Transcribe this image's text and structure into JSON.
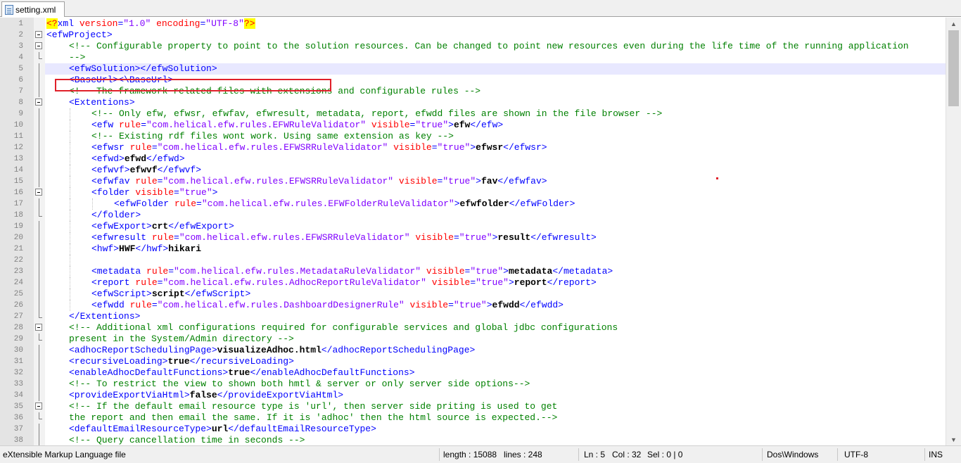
{
  "tab": {
    "label": "setting.xml"
  },
  "status": {
    "file_type": "eXtensible Markup Language file",
    "length": "length : 15088",
    "lines": "lines : 248",
    "ln": "Ln : 5",
    "col": "Col : 32",
    "sel": "Sel : 0 | 0",
    "eol": "Dos\\Windows",
    "encoding": "UTF-8",
    "mode": "INS"
  },
  "colors": {
    "tag": "#0000ff",
    "attr": "#ff0000",
    "value": "#8000ff",
    "comment": "#008000",
    "highlight": "#e0202a"
  },
  "lines": [
    {
      "n": "1",
      "i": 0,
      "s": [
        [
          "pi",
          "<?"
        ],
        [
          "tag",
          "xml "
        ],
        [
          "attr",
          "version"
        ],
        [
          "tag",
          "="
        ],
        [
          "val",
          "\"1.0\" "
        ],
        [
          "attr",
          "encoding"
        ],
        [
          "tag",
          "="
        ],
        [
          "val",
          "\"UTF-8\""
        ],
        [
          "pi",
          "?>"
        ]
      ]
    },
    {
      "n": "2",
      "i": 0,
      "s": [
        [
          "tag",
          "<efwProject>"
        ]
      ]
    },
    {
      "n": "3",
      "i": 1,
      "s": [
        [
          "com",
          "<!-- Configurable property to point to the solution resources. Can be changed to point new resources even during the life time of the running application"
        ]
      ]
    },
    {
      "n": "4",
      "i": 1,
      "s": [
        [
          "com",
          "-->"
        ]
      ]
    },
    {
      "n": "5",
      "i": 1,
      "cur": true,
      "s": [
        [
          "tag",
          "<efwSolution></efwSolution>"
        ]
      ]
    },
    {
      "n": "6",
      "i": 1,
      "s": [
        [
          "tag",
          "<BaseUrl><\\BaseUrl>"
        ]
      ]
    },
    {
      "n": "7",
      "i": 1,
      "s": [
        [
          "com",
          "<!-- The framework related files with extensions and configurable rules -->"
        ]
      ]
    },
    {
      "n": "8",
      "i": 1,
      "s": [
        [
          "tag",
          "<Extentions>"
        ]
      ]
    },
    {
      "n": "9",
      "i": 2,
      "s": [
        [
          "com",
          "<!-- Only efw, efwsr, efwfav, efwresult, metadata, report, efwdd files are shown in the file browser -->"
        ]
      ]
    },
    {
      "n": "10",
      "i": 2,
      "s": [
        [
          "tag",
          "<efw "
        ],
        [
          "attr",
          "rule"
        ],
        [
          "tag",
          "="
        ],
        [
          "val",
          "\"com.helical.efw.rules.EFWRuleValidator\" "
        ],
        [
          "attr",
          "visible"
        ],
        [
          "tag",
          "="
        ],
        [
          "val",
          "\"true\""
        ],
        [
          "tag",
          ">"
        ],
        [
          "txt",
          "efw"
        ],
        [
          "tag",
          "</efw>"
        ]
      ]
    },
    {
      "n": "11",
      "i": 2,
      "s": [
        [
          "com",
          "<!-- Existing rdf files wont work. Using same extension as key -->"
        ]
      ]
    },
    {
      "n": "12",
      "i": 2,
      "s": [
        [
          "tag",
          "<efwsr "
        ],
        [
          "attr",
          "rule"
        ],
        [
          "tag",
          "="
        ],
        [
          "val",
          "\"com.helical.efw.rules.EFWSRRuleValidator\" "
        ],
        [
          "attr",
          "visible"
        ],
        [
          "tag",
          "="
        ],
        [
          "val",
          "\"true\""
        ],
        [
          "tag",
          ">"
        ],
        [
          "txt",
          "efwsr"
        ],
        [
          "tag",
          "</efwsr>"
        ]
      ]
    },
    {
      "n": "13",
      "i": 2,
      "s": [
        [
          "tag",
          "<efwd>"
        ],
        [
          "txt",
          "efwd"
        ],
        [
          "tag",
          "</efwd>"
        ]
      ]
    },
    {
      "n": "14",
      "i": 2,
      "s": [
        [
          "tag",
          "<efwvf>"
        ],
        [
          "txt",
          "efwvf"
        ],
        [
          "tag",
          "</efwvf>"
        ]
      ]
    },
    {
      "n": "15",
      "i": 2,
      "s": [
        [
          "tag",
          "<efwfav "
        ],
        [
          "attr",
          "rule"
        ],
        [
          "tag",
          "="
        ],
        [
          "val",
          "\"com.helical.efw.rules.EFWSRRuleValidator\" "
        ],
        [
          "attr",
          "visible"
        ],
        [
          "tag",
          "="
        ],
        [
          "val",
          "\"true\""
        ],
        [
          "tag",
          ">"
        ],
        [
          "txt",
          "fav"
        ],
        [
          "tag",
          "</efwfav>"
        ]
      ]
    },
    {
      "n": "16",
      "i": 2,
      "s": [
        [
          "tag",
          "<folder "
        ],
        [
          "attr",
          "visible"
        ],
        [
          "tag",
          "="
        ],
        [
          "val",
          "\"true\""
        ],
        [
          "tag",
          ">"
        ]
      ]
    },
    {
      "n": "17",
      "i": 3,
      "s": [
        [
          "tag",
          "<efwFolder "
        ],
        [
          "attr",
          "rule"
        ],
        [
          "tag",
          "="
        ],
        [
          "val",
          "\"com.helical.efw.rules.EFWFolderRuleValidator\""
        ],
        [
          "tag",
          ">"
        ],
        [
          "txt",
          "efwfolder"
        ],
        [
          "tag",
          "</efwFolder>"
        ]
      ]
    },
    {
      "n": "18",
      "i": 2,
      "s": [
        [
          "tag",
          "</folder>"
        ]
      ]
    },
    {
      "n": "19",
      "i": 2,
      "s": [
        [
          "tag",
          "<efwExport>"
        ],
        [
          "txt",
          "crt"
        ],
        [
          "tag",
          "</efwExport>"
        ]
      ]
    },
    {
      "n": "20",
      "i": 2,
      "s": [
        [
          "tag",
          "<efwresult "
        ],
        [
          "attr",
          "rule"
        ],
        [
          "tag",
          "="
        ],
        [
          "val",
          "\"com.helical.efw.rules.EFWSRRuleValidator\" "
        ],
        [
          "attr",
          "visible"
        ],
        [
          "tag",
          "="
        ],
        [
          "val",
          "\"true\""
        ],
        [
          "tag",
          ">"
        ],
        [
          "txt",
          "result"
        ],
        [
          "tag",
          "</efwresult>"
        ]
      ]
    },
    {
      "n": "21",
      "i": 2,
      "s": [
        [
          "tag",
          "<hwf>"
        ],
        [
          "txt",
          "HWF"
        ],
        [
          "tag",
          "</hwf>"
        ],
        [
          "txt",
          "hikari"
        ]
      ]
    },
    {
      "n": "22",
      "i": 2,
      "s": []
    },
    {
      "n": "23",
      "i": 2,
      "s": [
        [
          "tag",
          "<metadata "
        ],
        [
          "attr",
          "rule"
        ],
        [
          "tag",
          "="
        ],
        [
          "val",
          "\"com.helical.efw.rules.MetadataRuleValidator\" "
        ],
        [
          "attr",
          "visible"
        ],
        [
          "tag",
          "="
        ],
        [
          "val",
          "\"true\""
        ],
        [
          "tag",
          ">"
        ],
        [
          "txt",
          "metadata"
        ],
        [
          "tag",
          "</metadata>"
        ]
      ]
    },
    {
      "n": "24",
      "i": 2,
      "s": [
        [
          "tag",
          "<report "
        ],
        [
          "attr",
          "rule"
        ],
        [
          "tag",
          "="
        ],
        [
          "val",
          "\"com.helical.efw.rules.AdhocReportRuleValidator\" "
        ],
        [
          "attr",
          "visible"
        ],
        [
          "tag",
          "="
        ],
        [
          "val",
          "\"true\""
        ],
        [
          "tag",
          ">"
        ],
        [
          "txt",
          "report"
        ],
        [
          "tag",
          "</report>"
        ]
      ]
    },
    {
      "n": "25",
      "i": 2,
      "s": [
        [
          "tag",
          "<efwScript>"
        ],
        [
          "txt",
          "script"
        ],
        [
          "tag",
          "</efwScript>"
        ]
      ]
    },
    {
      "n": "26",
      "i": 2,
      "s": [
        [
          "tag",
          "<efwdd "
        ],
        [
          "attr",
          "rule"
        ],
        [
          "tag",
          "="
        ],
        [
          "val",
          "\"com.helical.efw.rules.DashboardDesignerRule\" "
        ],
        [
          "attr",
          "visible"
        ],
        [
          "tag",
          "="
        ],
        [
          "val",
          "\"true\""
        ],
        [
          "tag",
          ">"
        ],
        [
          "txt",
          "efwdd"
        ],
        [
          "tag",
          "</efwdd>"
        ]
      ]
    },
    {
      "n": "27",
      "i": 1,
      "s": [
        [
          "tag",
          "</Extentions>"
        ]
      ]
    },
    {
      "n": "28",
      "i": 1,
      "s": [
        [
          "com",
          "<!-- Additional xml configurations required for configurable services and global jdbc configurations"
        ]
      ]
    },
    {
      "n": "29",
      "i": 1,
      "s": [
        [
          "com",
          "present in the System/Admin directory -->"
        ]
      ]
    },
    {
      "n": "30",
      "i": 1,
      "s": [
        [
          "tag",
          "<adhocReportSchedulingPage>"
        ],
        [
          "txt",
          "visualizeAdhoc.html"
        ],
        [
          "tag",
          "</adhocReportSchedulingPage>"
        ]
      ]
    },
    {
      "n": "31",
      "i": 1,
      "s": [
        [
          "tag",
          "<recursiveLoading>"
        ],
        [
          "txt",
          "true"
        ],
        [
          "tag",
          "</recursiveLoading>"
        ]
      ]
    },
    {
      "n": "32",
      "i": 1,
      "s": [
        [
          "tag",
          "<enableAdhocDefaultFunctions>"
        ],
        [
          "txt",
          "true"
        ],
        [
          "tag",
          "</enableAdhocDefaultFunctions>"
        ]
      ]
    },
    {
      "n": "33",
      "i": 1,
      "s": [
        [
          "com",
          "<!-- To restrict the view to shown both hmtl & server or only server side options-->"
        ]
      ]
    },
    {
      "n": "34",
      "i": 1,
      "s": [
        [
          "tag",
          "<provideExportViaHtml>"
        ],
        [
          "txt",
          "false"
        ],
        [
          "tag",
          "</provideExportViaHtml>"
        ]
      ]
    },
    {
      "n": "35",
      "i": 1,
      "s": [
        [
          "com",
          "<!-- If the default email resource type is 'url', then server side priting is used to get"
        ]
      ]
    },
    {
      "n": "36",
      "i": 1,
      "s": [
        [
          "com",
          "the report and then email the same. If it is 'adhoc' then the html source is expected.-->"
        ]
      ]
    },
    {
      "n": "37",
      "i": 1,
      "s": [
        [
          "tag",
          "<defaultEmailResourceType>"
        ],
        [
          "txt",
          "url"
        ],
        [
          "tag",
          "</defaultEmailResourceType>"
        ]
      ]
    },
    {
      "n": "38",
      "i": 1,
      "s": [
        [
          "com",
          "<!-- Query cancellation time in seconds -->"
        ]
      ]
    }
  ]
}
